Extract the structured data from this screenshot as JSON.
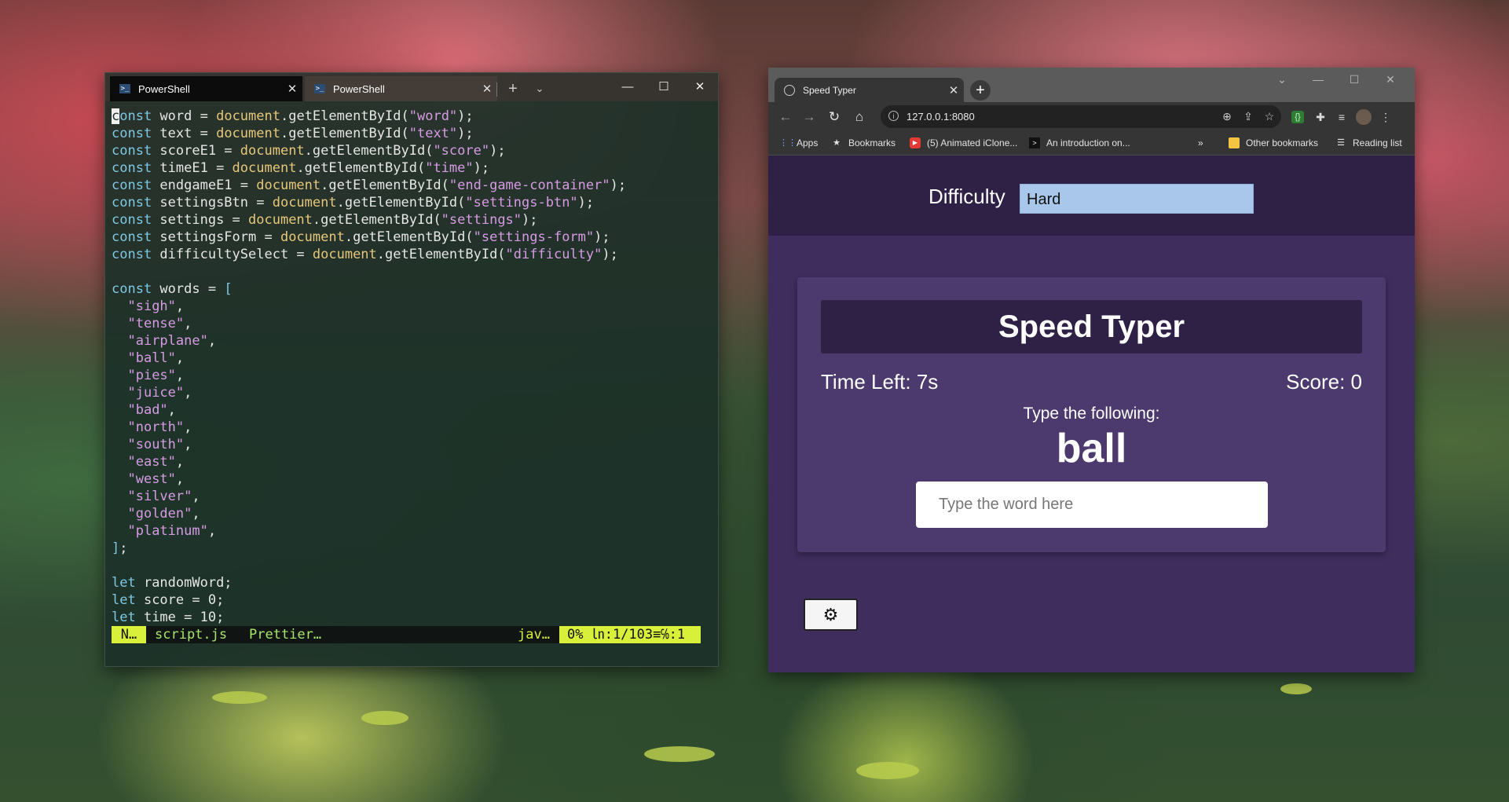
{
  "terminal": {
    "tabs": [
      {
        "label": "PowerShell",
        "active": true
      },
      {
        "label": "PowerShell",
        "active": false
      }
    ],
    "code_lines": [
      [
        {
          "t": "const",
          "c": "kw",
          "cursor": true
        },
        {
          "t": " word = "
        },
        {
          "t": "document",
          "c": "fn"
        },
        {
          "t": ".getElementById("
        },
        {
          "t": "\"word\"",
          "c": "str"
        },
        {
          "t": ");"
        }
      ],
      [
        {
          "t": "const",
          "c": "kw"
        },
        {
          "t": " text = "
        },
        {
          "t": "document",
          "c": "fn"
        },
        {
          "t": ".getElementById("
        },
        {
          "t": "\"text\"",
          "c": "str"
        },
        {
          "t": ");"
        }
      ],
      [
        {
          "t": "const",
          "c": "kw"
        },
        {
          "t": " scoreE1 = "
        },
        {
          "t": "document",
          "c": "fn"
        },
        {
          "t": ".getElementById("
        },
        {
          "t": "\"score\"",
          "c": "str"
        },
        {
          "t": ");"
        }
      ],
      [
        {
          "t": "const",
          "c": "kw"
        },
        {
          "t": " timeE1 = "
        },
        {
          "t": "document",
          "c": "fn"
        },
        {
          "t": ".getElementById("
        },
        {
          "t": "\"time\"",
          "c": "str"
        },
        {
          "t": ");"
        }
      ],
      [
        {
          "t": "const",
          "c": "kw"
        },
        {
          "t": " endgameE1 = "
        },
        {
          "t": "document",
          "c": "fn"
        },
        {
          "t": ".getElementById("
        },
        {
          "t": "\"end-game-container\"",
          "c": "str"
        },
        {
          "t": ");"
        }
      ],
      [
        {
          "t": "const",
          "c": "kw"
        },
        {
          "t": " settingsBtn = "
        },
        {
          "t": "document",
          "c": "fn"
        },
        {
          "t": ".getElementById("
        },
        {
          "t": "\"settings-btn\"",
          "c": "str"
        },
        {
          "t": ");"
        }
      ],
      [
        {
          "t": "const",
          "c": "kw"
        },
        {
          "t": " settings = "
        },
        {
          "t": "document",
          "c": "fn"
        },
        {
          "t": ".getElementById("
        },
        {
          "t": "\"settings\"",
          "c": "str"
        },
        {
          "t": ");"
        }
      ],
      [
        {
          "t": "const",
          "c": "kw"
        },
        {
          "t": " settingsForm = "
        },
        {
          "t": "document",
          "c": "fn"
        },
        {
          "t": ".getElementById("
        },
        {
          "t": "\"settings-form\"",
          "c": "str"
        },
        {
          "t": ");"
        }
      ],
      [
        {
          "t": "const",
          "c": "kw"
        },
        {
          "t": " difficultySelect = "
        },
        {
          "t": "document",
          "c": "fn"
        },
        {
          "t": ".getElementById("
        },
        {
          "t": "\"difficulty\"",
          "c": "str"
        },
        {
          "t": ");"
        }
      ],
      [],
      [
        {
          "t": "const",
          "c": "kw"
        },
        {
          "t": " words = "
        },
        {
          "t": "[",
          "c": "kw"
        }
      ],
      [
        {
          "t": "  "
        },
        {
          "t": "\"sigh\"",
          "c": "str"
        },
        {
          "t": ","
        }
      ],
      [
        {
          "t": "  "
        },
        {
          "t": "\"tense\"",
          "c": "str"
        },
        {
          "t": ","
        }
      ],
      [
        {
          "t": "  "
        },
        {
          "t": "\"airplane\"",
          "c": "str"
        },
        {
          "t": ","
        }
      ],
      [
        {
          "t": "  "
        },
        {
          "t": "\"ball\"",
          "c": "str"
        },
        {
          "t": ","
        }
      ],
      [
        {
          "t": "  "
        },
        {
          "t": "\"pies\"",
          "c": "str"
        },
        {
          "t": ","
        }
      ],
      [
        {
          "t": "  "
        },
        {
          "t": "\"juice\"",
          "c": "str"
        },
        {
          "t": ","
        }
      ],
      [
        {
          "t": "  "
        },
        {
          "t": "\"bad\"",
          "c": "str"
        },
        {
          "t": ","
        }
      ],
      [
        {
          "t": "  "
        },
        {
          "t": "\"north\"",
          "c": "str"
        },
        {
          "t": ","
        }
      ],
      [
        {
          "t": "  "
        },
        {
          "t": "\"south\"",
          "c": "str"
        },
        {
          "t": ","
        }
      ],
      [
        {
          "t": "  "
        },
        {
          "t": "\"east\"",
          "c": "str"
        },
        {
          "t": ","
        }
      ],
      [
        {
          "t": "  "
        },
        {
          "t": "\"west\"",
          "c": "str"
        },
        {
          "t": ","
        }
      ],
      [
        {
          "t": "  "
        },
        {
          "t": "\"silver\"",
          "c": "str"
        },
        {
          "t": ","
        }
      ],
      [
        {
          "t": "  "
        },
        {
          "t": "\"golden\"",
          "c": "str"
        },
        {
          "t": ","
        }
      ],
      [
        {
          "t": "  "
        },
        {
          "t": "\"platinum\"",
          "c": "str"
        },
        {
          "t": ","
        }
      ],
      [
        {
          "t": "]",
          "c": "kw"
        },
        {
          "t": ";"
        }
      ],
      [],
      [
        {
          "t": "let",
          "c": "kw"
        },
        {
          "t": " randomWord;"
        }
      ],
      [
        {
          "t": "let",
          "c": "kw"
        },
        {
          "t": " score = 0;"
        }
      ],
      [
        {
          "t": "let",
          "c": "kw"
        },
        {
          "t": " time = 10;"
        }
      ]
    ],
    "status": {
      "mode": "N…",
      "file": "script.js",
      "formatter": "Prettier…",
      "lang": "jav…",
      "position": "0%  ㏑:1/103≡℅:1"
    }
  },
  "browser": {
    "tab_title": "Speed Typer",
    "url": "127.0.0.1:8080",
    "bookmarks": [
      "Apps",
      "Bookmarks",
      "(5) Animated iClone...",
      "An introduction on...",
      "Other bookmarks",
      "Reading list"
    ],
    "overflow": "»"
  },
  "game": {
    "difficulty_label": "Difficulty",
    "difficulty_value": "Hard",
    "title": "Speed Typer",
    "time_left": "Time Left: 7s",
    "score": "Score: 0",
    "prompt": "Type the following:",
    "word": "ball",
    "input_placeholder": "Type the word here"
  },
  "colors": {
    "page_bg": "#3f2d5e",
    "header_bg": "#2f2145",
    "card_bg": "#4c3a6e",
    "select_bg": "#a8c7eb"
  },
  "icons": [
    "powershell-icon",
    "close-icon",
    "plus-icon",
    "chevron-down-icon",
    "minimize-icon",
    "maximize-icon",
    "globe-icon",
    "back-icon",
    "forward-icon",
    "reload-icon",
    "home-icon",
    "info-icon",
    "zoom-icon",
    "share-icon",
    "star-icon",
    "extension-icon",
    "puzzle-icon",
    "media-icon",
    "avatar",
    "menu-icon",
    "gear-icon"
  ]
}
